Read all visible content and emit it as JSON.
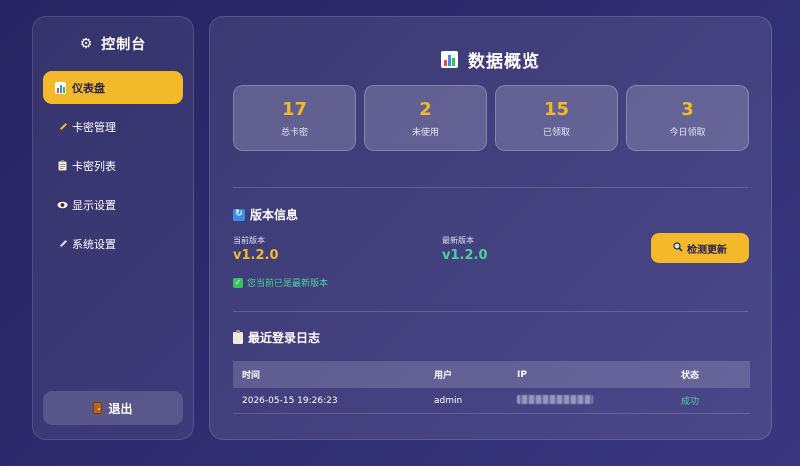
{
  "sidebar": {
    "title": "控制台",
    "items": [
      {
        "label": "仪表盘",
        "icon": "bar-chart-icon",
        "active": true
      },
      {
        "label": "卡密管理",
        "icon": "pencil-icon"
      },
      {
        "label": "卡密列表",
        "icon": "clipboard-icon"
      },
      {
        "label": "显示设置",
        "icon": "eye-icon"
      },
      {
        "label": "系统设置",
        "icon": "pencil-icon"
      }
    ],
    "logout_label": "退出"
  },
  "main": {
    "title": "数据概览",
    "stats": [
      {
        "value": "17",
        "label": "总卡密"
      },
      {
        "value": "2",
        "label": "未使用"
      },
      {
        "value": "15",
        "label": "已领取"
      },
      {
        "value": "3",
        "label": "今日领取"
      }
    ],
    "version": {
      "section_title": "版本信息",
      "current_label": "当前版本",
      "current_value": "v1.2.0",
      "latest_label": "最新版本",
      "latest_value": "v1.2.0",
      "status_text": "您当前已是最新版本",
      "check_button": "检测更新"
    },
    "log": {
      "section_title": "最近登录日志",
      "headers": {
        "time": "时间",
        "user": "用户",
        "ip": "IP",
        "status": "状态"
      },
      "rows": [
        {
          "time": "2026-05-15 19:26:23",
          "user": "admin",
          "status": "成功"
        }
      ]
    }
  },
  "colors": {
    "accent": "#f3b92a",
    "success": "#4cd29a",
    "background": "#2e2c6e"
  }
}
